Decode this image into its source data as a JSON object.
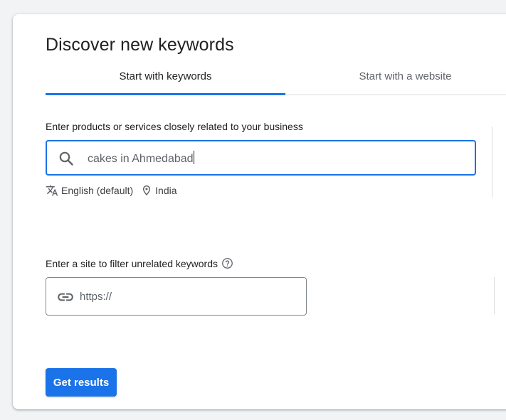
{
  "card": {
    "title": "Discover new keywords"
  },
  "tabs": [
    {
      "label": "Start with keywords",
      "active": true
    },
    {
      "label": "Start with a website",
      "active": false
    }
  ],
  "keywords": {
    "label": "Enter products or services closely related to your business",
    "value": "cakes in Ahmedabad",
    "icon": "search-icon"
  },
  "targeting": {
    "language": "English (default)",
    "location": "India",
    "language_icon": "translate-icon",
    "location_icon": "location-pin-icon"
  },
  "site_filter": {
    "label": "Enter a site to filter unrelated keywords",
    "placeholder": "https://",
    "icon": "link-icon",
    "help_icon": "help-icon"
  },
  "actions": {
    "get_results": "Get results"
  },
  "colors": {
    "accent": "#1a73e8",
    "divider": "#dadce0",
    "text": "#202124",
    "muted": "#5f6368"
  }
}
